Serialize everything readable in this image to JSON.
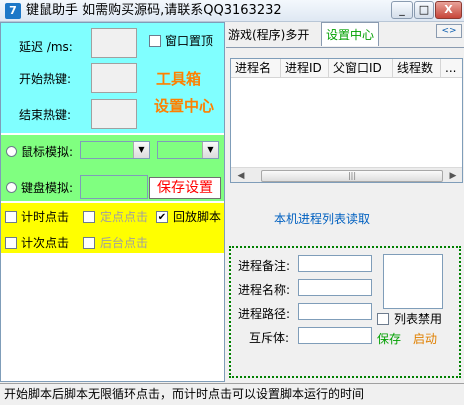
{
  "window": {
    "title": "键鼠助手   如需购买源码,请联系QQ3163232",
    "icon_glyph": "7",
    "controls": [
      "_",
      "□",
      "X"
    ]
  },
  "left": {
    "delay_label": "延迟 /ms:",
    "start_hotkey_label": "开始热键:",
    "end_hotkey_label": "结束热键:",
    "topmost_label": "窗口置顶",
    "toolbox_line1": "工具箱",
    "toolbox_line2": "设置中心",
    "mouse_sim_label": "鼠标模拟:",
    "keyboard_sim_label": "键盘模拟:",
    "save_settings_label": "保存设置",
    "timed_click_label": "计时点击",
    "fixed_point_click_label": "定点点击",
    "playback_script_label": "回放脚本",
    "playback_checked": true,
    "count_click_label": "计次点击",
    "background_click_label": "后台点击"
  },
  "tabs": {
    "game_tab": "游戏(程序)多开",
    "settings_tab": "设置中心",
    "scroll_arrows": "<>"
  },
  "process_list": {
    "columns": [
      "进程名",
      "进程ID",
      "父窗口ID",
      "线程数",
      "..."
    ],
    "read_link": "本机进程列表读取"
  },
  "process_form": {
    "remark_label": "进程备注:",
    "name_label": "进程名称:",
    "path_label": "进程路径:",
    "mutex_label": "互斥体:",
    "disable_list_label": "列表禁用",
    "save_label": "保存",
    "start_label": "启动"
  },
  "statusbar": {
    "text": "开始脚本后脚本无限循环点击，而计时点击可以设置脚本运行的时间"
  },
  "colors": {
    "cyan_section": "#80ffff",
    "green_section": "#80ff80",
    "yellow_section": "#ffff00",
    "accent_orange": "#ff8000",
    "save_red": "#ff0000",
    "link_blue": "#0060c0",
    "tab_green": "#00a000"
  }
}
